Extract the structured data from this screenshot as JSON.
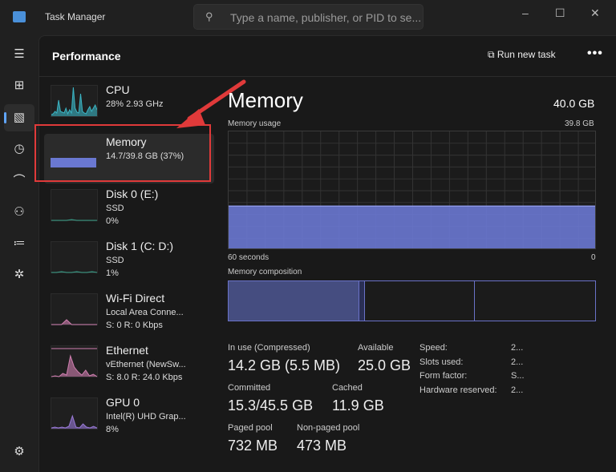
{
  "window": {
    "title": "Task Manager",
    "search_placeholder": "Type a name, publisher, or PID to se...",
    "minimize": "–",
    "maximize": "☐",
    "close": "✕"
  },
  "rail": {
    "icons": [
      "hamburger-icon",
      "processes-icon",
      "performance-icon",
      "app-history-icon",
      "startup-apps-icon",
      "users-icon",
      "details-icon",
      "services-icon"
    ],
    "settings": "settings-icon"
  },
  "header": {
    "title": "Performance",
    "run_new_task": "Run new task",
    "more": "•••"
  },
  "devices": [
    {
      "name": "CPU",
      "line2": "28% 2.93 GHz",
      "line3": "",
      "color": "#3bb5c4"
    },
    {
      "name": "Memory",
      "line2": "14.7/39.8 GB (37%)",
      "line3": "",
      "color": "#6a78d1",
      "selected": true
    },
    {
      "name": "Disk 0 (E:)",
      "line2": "SSD",
      "line3": "0%",
      "color": "#3aa08a"
    },
    {
      "name": "Disk 1 (C: D:)",
      "line2": "SSD",
      "line3": "1%",
      "color": "#3aa08a"
    },
    {
      "name": "Wi-Fi Direct",
      "line2": "Local Area Conne...",
      "line3": "S: 0 R: 0 Kbps",
      "color": "#d07fb0"
    },
    {
      "name": "Ethernet",
      "line2": "vEthernet (NewSw...",
      "line3": "S: 8.0 R: 24.0 Kbps",
      "color": "#d07fb0"
    },
    {
      "name": "GPU 0",
      "line2": "Intel(R) UHD Grap...",
      "line3": "8%",
      "color": "#9a7ad8"
    }
  ],
  "main": {
    "title": "Memory",
    "total": "40.0 GB",
    "usage_label": "Memory usage",
    "usage_max": "39.8 GB",
    "x_left": "60 seconds",
    "x_right": "0",
    "usage_fraction": 0.37,
    "composition_label": "Memory composition",
    "composition_gb": {
      "in_use": 14.2,
      "modified": 0.6,
      "standby": 11.9,
      "free": 13.1
    },
    "stats": {
      "in_use_label": "In use (Compressed)",
      "in_use": "14.2 GB (5.5 MB)",
      "available_label": "Available",
      "available": "25.0 GB",
      "committed_label": "Committed",
      "committed": "15.3/45.5 GB",
      "cached_label": "Cached",
      "cached": "11.9 GB",
      "paged_label": "Paged pool",
      "paged": "732 MB",
      "nonpaged_label": "Non-paged pool",
      "nonpaged": "473 MB"
    },
    "props": [
      {
        "k": "Speed:",
        "v": "2..."
      },
      {
        "k": "Slots used:",
        "v": "2..."
      },
      {
        "k": "Form factor:",
        "v": "S..."
      },
      {
        "k": "Hardware reserved:",
        "v": "2..."
      }
    ]
  },
  "colors": {
    "accent": "#6a78d1",
    "annotation": "#e03a3a"
  }
}
